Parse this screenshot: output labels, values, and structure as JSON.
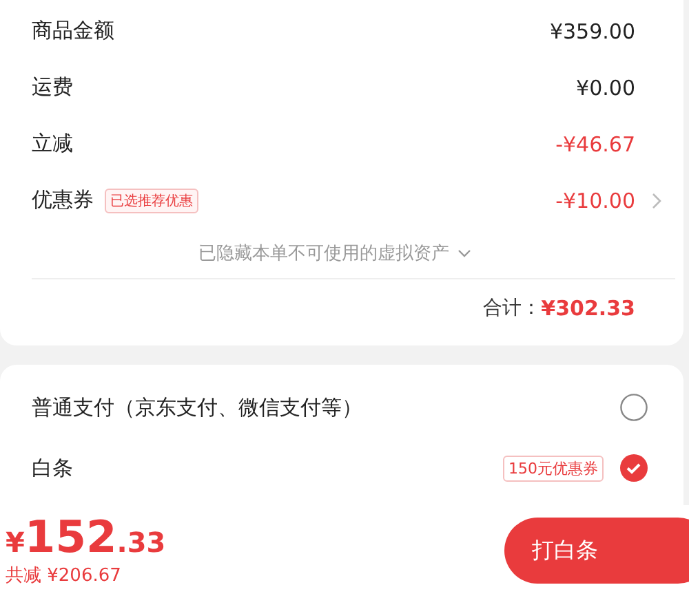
{
  "summary": {
    "rows": [
      {
        "label": "商品金额",
        "amount": "¥359.00",
        "kind": "plain",
        "has_arrow": false
      },
      {
        "label": "运费",
        "amount": "¥0.00",
        "kind": "plain",
        "has_arrow": false
      },
      {
        "label": "立减",
        "amount": "-¥46.67",
        "kind": "discount",
        "has_arrow": false
      },
      {
        "label": "优惠券",
        "tag": "已选推荐优惠",
        "amount": "-¥10.00",
        "kind": "discount",
        "has_arrow": true
      }
    ],
    "hidden_note": "已隐藏本单不可使用的虚拟资产",
    "total_label": "合计：",
    "total_amount": "¥302.33"
  },
  "payment_methods": [
    {
      "label": "普通支付（京东支付、微信支付等）",
      "selected": false
    },
    {
      "label": "白条",
      "badge": "150元优惠券",
      "selected": true
    }
  ],
  "footer": {
    "currency": "¥",
    "integer": "152",
    "decimal": ".33",
    "saved": "共减 ¥206.67",
    "button": "打白条"
  }
}
